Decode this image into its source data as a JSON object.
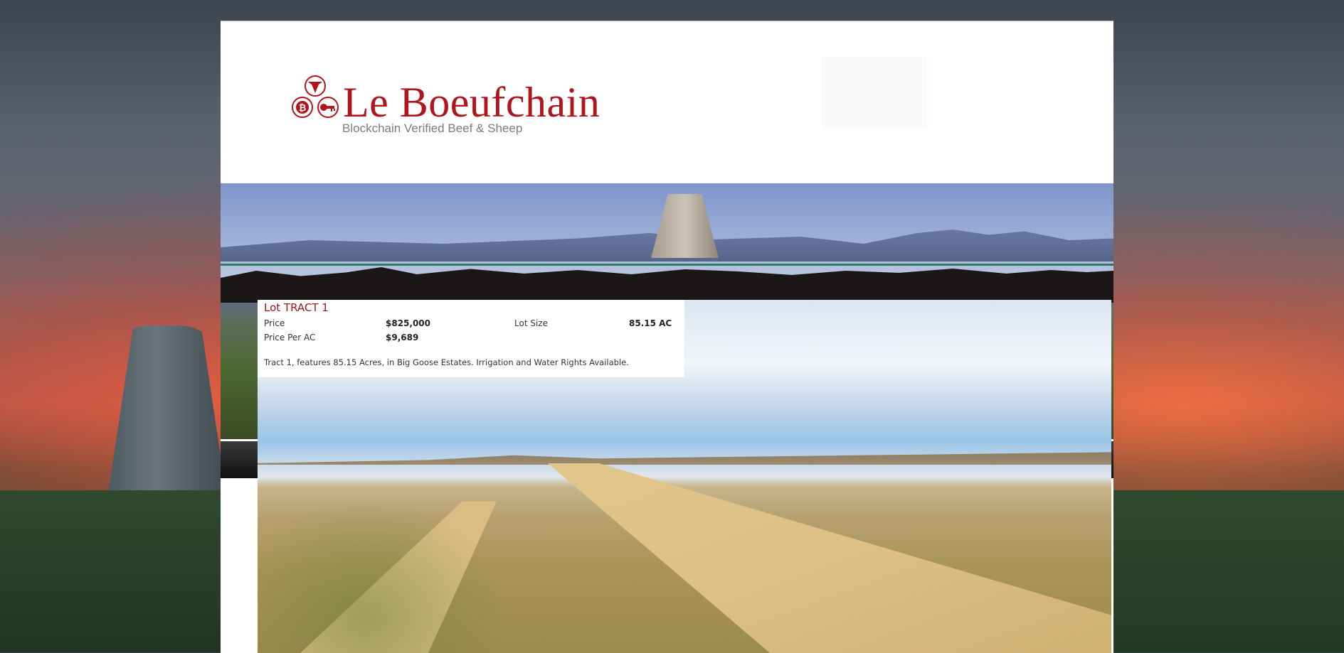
{
  "brand": {
    "name": "Le Boeufchain",
    "tagline": "Blockchain Verified Beef & Sheep",
    "colors": {
      "brand_red": "#b0151d",
      "tagline_gray": "#7c7c7c"
    }
  },
  "listing": {
    "title": "Lot TRACT 1",
    "price_label": "Price",
    "price_value": "$825,000",
    "lot_size_label": "Lot Size",
    "lot_size_value": "85.15 AC",
    "price_per_ac_label": "Price Per AC",
    "price_per_ac_value": "$9,689",
    "description": "Tract 1, features 85.15 Acres, in Big Goose Estates. Irrigation and Water Rights Available."
  },
  "icons": [
    "steer-head-icon",
    "bitcoin-icon",
    "key-icon"
  ]
}
